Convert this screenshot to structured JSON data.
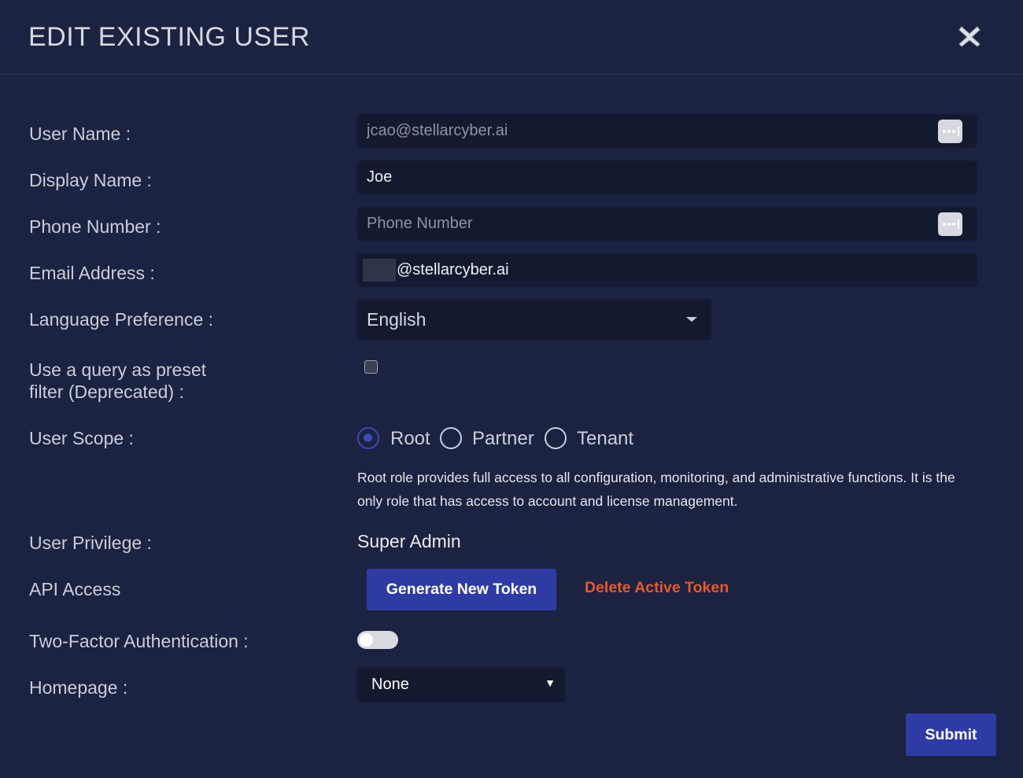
{
  "modal": {
    "title": "EDIT EXISTING USER"
  },
  "form": {
    "user_name": {
      "label": "User Name :",
      "value": "jcao@stellarcyber.ai"
    },
    "display_name": {
      "label": "Display Name :",
      "value": "Joe"
    },
    "phone_number": {
      "label": "Phone Number :",
      "placeholder": "Phone Number",
      "value": ""
    },
    "email_address": {
      "label": "Email Address :",
      "value": "@stellarcyber.ai"
    },
    "language_preference": {
      "label": "Language Preference :",
      "selected": "English"
    },
    "preset_filter": {
      "label_line1": "Use a query as preset",
      "label_line2": "filter (Deprecated) :",
      "checked": false
    },
    "user_scope": {
      "label": "User Scope :",
      "options": [
        "Root",
        "Partner",
        "Tenant"
      ],
      "selected": "Root",
      "description_line1": "Root role provides full access to all configuration, monitoring, and administrative functions. It is the",
      "description_line2": "only role that has access to account and license management."
    },
    "user_privilege": {
      "label": "User Privilege :",
      "value": "Super Admin"
    },
    "api_access": {
      "label": "API Access",
      "generate_label": "Generate New Token",
      "delete_label": "Delete Active Token"
    },
    "two_factor": {
      "label": "Two-Factor Authentication :",
      "enabled": false
    },
    "homepage": {
      "label": "Homepage :",
      "selected": "None"
    }
  },
  "actions": {
    "submit_label": "Submit"
  },
  "colors": {
    "background": "#1b2340",
    "field_background": "#131a30",
    "primary_button": "#2f3ba4",
    "danger_link": "#e8582e",
    "radio_selected": "#3f48b3"
  },
  "icons": {
    "close": "close-icon",
    "password_manager": "password-manager-icon",
    "dropdown": "caret-down-icon"
  }
}
